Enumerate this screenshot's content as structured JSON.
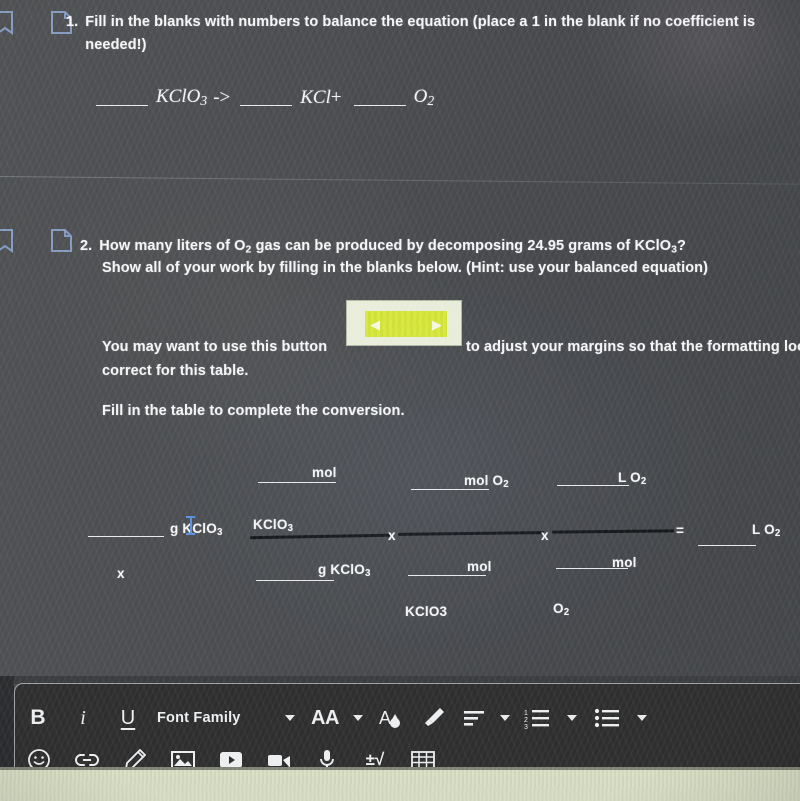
{
  "app": {
    "kind": "online-worksheet-rich-text-editor"
  },
  "questions": [
    {
      "number": "1.",
      "prompt_line1": "Fill in the blanks with numbers to balance the equation (place a 1 in the blank if no coefficient is",
      "prompt_line2": "needed!)",
      "equation": {
        "reactant": "KClO",
        "reactant_sub": "3",
        "arrow": "->",
        "product1": "KCl",
        "plus": "+",
        "product2": "O",
        "product2_sub": "2",
        "blank_placeholder": ""
      },
      "icons": {
        "bookmark": "bookmark-icon",
        "note": "note-icon"
      }
    },
    {
      "number": "2.",
      "prompt_line1_a": "How many liters of O",
      "prompt_line1_sub": "2",
      "prompt_line1_b": " gas can be produced by decomposing 24.95 grams of KClO",
      "prompt_line1_sub2": "3",
      "prompt_line1_c": "?",
      "prompt_line2": "Show all of your work by filling in the blanks below. (Hint: use your balanced equation)",
      "button_sentence_before": "You may want to use this button",
      "button_sentence_after": "to adjust your margins so that the formatting looks",
      "button_sentence_line2": "correct for this table.",
      "table_instruction": "Fill in the table to complete the conversion.",
      "icons": {
        "bookmark": "bookmark-icon",
        "note": "note-icon"
      }
    }
  ],
  "margin_button": {
    "name": "adjust-margins-button-image",
    "left_arrow": "◀",
    "right_arrow": "▶",
    "highlight_color": "#d8e53a",
    "background_color": "#e8edd9"
  },
  "conversion": {
    "operators": {
      "multiply": "x",
      "equals": "="
    },
    "given": {
      "blank": "",
      "unit": "g KClO",
      "unit_sub": "3",
      "multiply_below": "x"
    },
    "factor1": {
      "numerator_blank": "",
      "numerator_unit": "mol",
      "numerator_unit2": "KClO",
      "numerator_unit2_sub": "3",
      "denominator_blank": "",
      "denominator_unit": "g KClO",
      "denominator_unit_sub": "3"
    },
    "factor2": {
      "numerator_blank": "",
      "numerator_unit": "mol O",
      "numerator_unit_sub": "2",
      "denominator_blank": "",
      "denominator_unit": "mol",
      "denominator_unit2": "KClO3"
    },
    "factor3": {
      "numerator_blank": "",
      "numerator_unit": "L O",
      "numerator_unit_sub": "2",
      "denominator_blank": "",
      "denominator_unit": "mol",
      "denominator_unit2": "O",
      "denominator_unit2_sub": "2"
    },
    "result": {
      "blank": "",
      "unit": "L O",
      "unit_sub": "2"
    }
  },
  "toolbar": {
    "row1": [
      {
        "name": "bold-button",
        "label": "B",
        "kind": "text"
      },
      {
        "name": "italic-button",
        "label": "i",
        "kind": "text"
      },
      {
        "name": "underline-button",
        "label": "U",
        "kind": "text"
      },
      {
        "name": "font-family-select",
        "label": "Font Family",
        "kind": "select"
      },
      {
        "name": "font-size-select",
        "label": "AA",
        "kind": "select"
      },
      {
        "name": "text-color-button",
        "label": "A",
        "kind": "icon"
      },
      {
        "name": "highlight-color-button",
        "label": "highlighter-icon",
        "kind": "icon"
      },
      {
        "name": "align-select",
        "label": "align-left-icon",
        "kind": "select"
      },
      {
        "name": "numbered-list-select",
        "label": "numbered-list-icon",
        "kind": "select"
      },
      {
        "name": "bullet-list-select",
        "label": "bullet-list-icon",
        "kind": "select"
      }
    ],
    "row2": [
      {
        "name": "emoji-button",
        "label": "emoji-icon"
      },
      {
        "name": "link-button",
        "label": "link-icon"
      },
      {
        "name": "draw-button",
        "label": "pencil-icon"
      },
      {
        "name": "insert-image-button",
        "label": "image-icon"
      },
      {
        "name": "insert-video-button",
        "label": "video-play-icon"
      },
      {
        "name": "record-video-button",
        "label": "camera-icon"
      },
      {
        "name": "record-audio-button",
        "label": "microphone-icon"
      },
      {
        "name": "equation-button",
        "label": "±√"
      },
      {
        "name": "insert-table-button",
        "label": "table-icon"
      }
    ]
  },
  "colors": {
    "background": "#4a4c4e",
    "text": "#f2f3f4",
    "toolbar_bg": "#2e2e2e",
    "icon_blue": "#8fa8d4",
    "caret_blue": "#5b8fe0",
    "highlight_yellow": "#d8e53a",
    "fraction_bar": "#121416"
  }
}
